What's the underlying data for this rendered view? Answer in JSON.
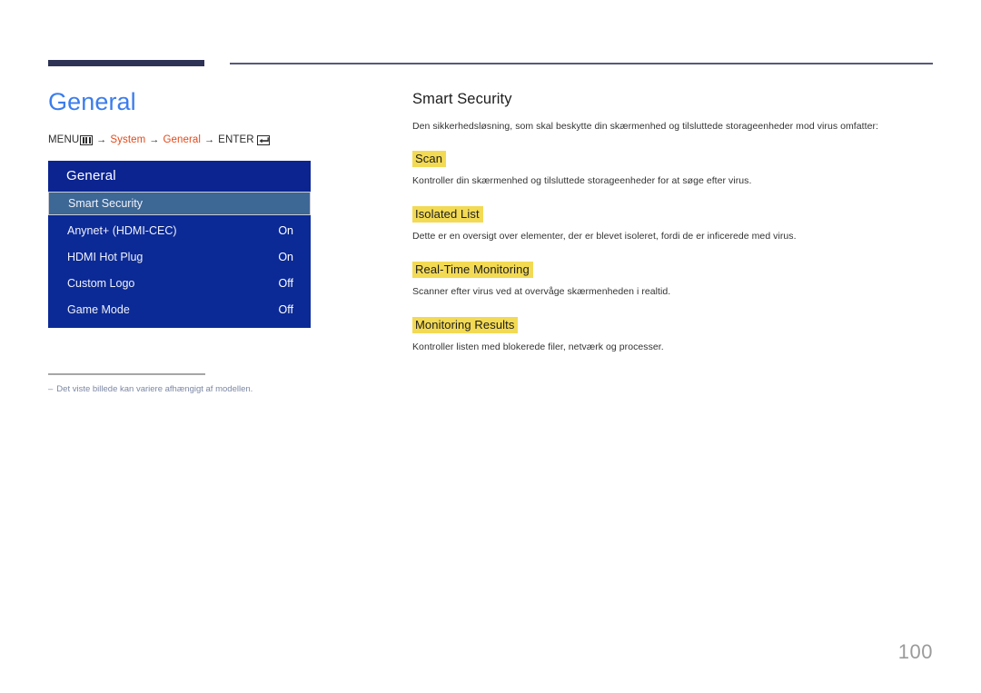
{
  "page": {
    "number": "100"
  },
  "left": {
    "title": "General",
    "breadcrumb": {
      "menu_label": "MENU",
      "menu_icon": "menu-bars-icon",
      "arrow": "→",
      "step1": "System",
      "step2": "General",
      "enter_label": "ENTER",
      "enter_icon": "enter-key-icon"
    },
    "osd": {
      "header": "General",
      "rows": [
        {
          "label": "Smart Security",
          "value": "",
          "selected": true
        },
        {
          "label": "Anynet+ (HDMI-CEC)",
          "value": "On",
          "selected": false
        },
        {
          "label": "HDMI Hot Plug",
          "value": "On",
          "selected": false
        },
        {
          "label": "Custom Logo",
          "value": "Off",
          "selected": false
        },
        {
          "label": "Game Mode",
          "value": "Off",
          "selected": false
        }
      ]
    },
    "footnote": {
      "dash": "–",
      "text": "Det viste billede kan variere afhængigt af modellen."
    }
  },
  "right": {
    "title": "Smart Security",
    "intro": "Den sikkerhedsløsning, som skal beskytte din skærmenhed og tilsluttede storageenheder mod virus omfatter:",
    "blocks": [
      {
        "heading": "Scan",
        "text": "Kontroller din skærmenhed og tilsluttede storageenheder for at søge efter virus."
      },
      {
        "heading": "Isolated List",
        "text": "Dette er en oversigt over elementer, der er blevet isoleret, fordi de er inficerede med virus."
      },
      {
        "heading": "Real-Time Monitoring",
        "text": "Scanner efter virus ved at overvåge skærmenheden i realtid."
      },
      {
        "heading": "Monitoring Results",
        "text": "Kontroller listen med blokerede filer, netværk og processer."
      }
    ]
  },
  "colors": {
    "accent_blue": "#3b7ded",
    "osd_blue": "#0b2a96",
    "osd_selected": "#3d6795",
    "highlight_yellow": "#f3da54",
    "breadcrumb_orange": "#e24a1a",
    "rule_navy": "#2e3255"
  }
}
